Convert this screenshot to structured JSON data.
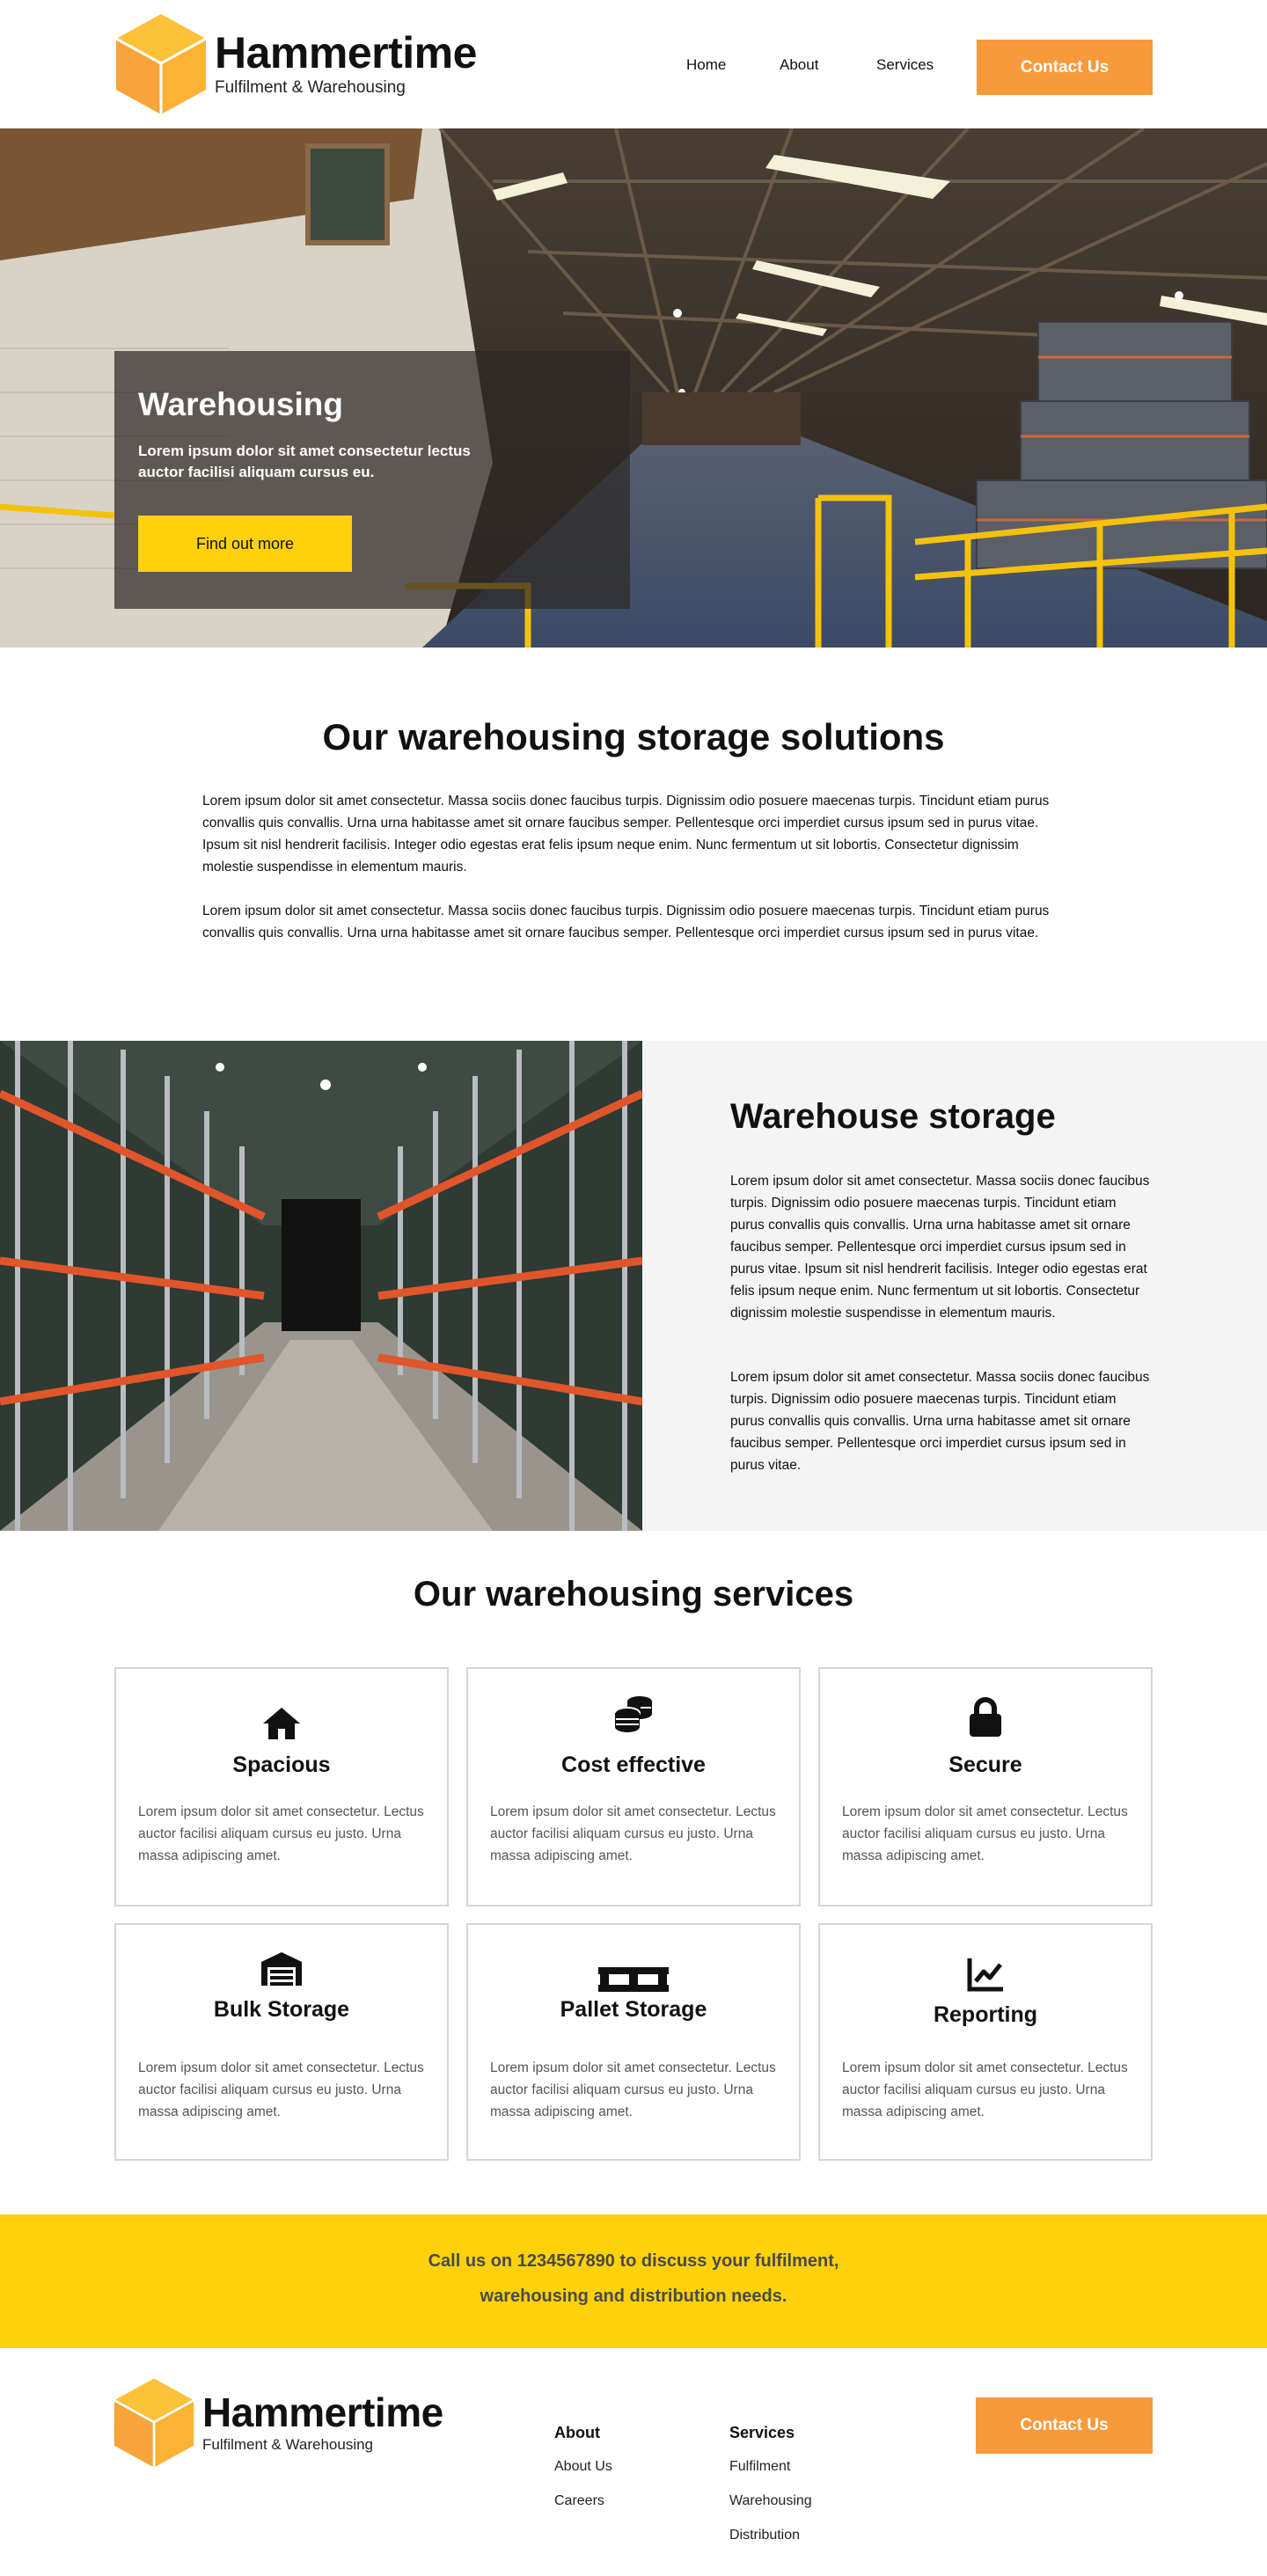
{
  "brand": {
    "name": "Hammertime",
    "tagline": "Fulfilment & Warehousing",
    "color_orange": "#f89a3c",
    "color_yellow": "#fdd20a"
  },
  "nav": {
    "items": [
      "Home",
      "About",
      "Services"
    ],
    "contact_label": "Contact Us"
  },
  "hero": {
    "title": "Warehousing",
    "text": "Lorem ipsum dolor sit amet consectetur lectus auctor facilisi aliquam cursus eu.",
    "button_label": "Find out more"
  },
  "solutions": {
    "title": "Our warehousing storage solutions",
    "paragraph1": "Lorem ipsum dolor sit amet consectetur. Massa sociis donec faucibus turpis. Dignissim odio posuere maecenas turpis. Tincidunt etiam purus convallis quis convallis. Urna urna habitasse amet sit ornare faucibus semper. Pellentesque orci imperdiet cursus ipsum sed in purus vitae. Ipsum sit nisl hendrerit facilisis. Integer odio egestas erat felis ipsum neque enim. Nunc fermentum ut sit lobortis. Consectetur dignissim molestie suspendisse in elementum mauris.",
    "paragraph2": "Lorem ipsum dolor sit amet consectetur. Massa sociis donec faucibus turpis. Dignissim odio posuere maecenas turpis. Tincidunt etiam purus convallis quis convallis. Urna urna habitasse amet sit ornare faucibus semper. Pellentesque orci imperdiet cursus ipsum sed in purus vitae."
  },
  "storage": {
    "title": "Warehouse storage",
    "paragraph1": "Lorem ipsum dolor sit amet consectetur. Massa sociis donec faucibus turpis. Dignissim odio posuere maecenas turpis. Tincidunt etiam purus convallis quis convallis. Urna urna habitasse amet sit ornare faucibus semper. Pellentesque orci imperdiet cursus ipsum sed in purus vitae. Ipsum sit nisl hendrerit facilisis. Integer odio egestas erat felis ipsum neque enim. Nunc fermentum ut sit lobortis. Consectetur dignissim molestie suspendisse in elementum mauris.",
    "paragraph2": "Lorem ipsum dolor sit amet consectetur. Massa sociis donec faucibus turpis. Dignissim odio posuere maecenas turpis. Tincidunt etiam purus convallis quis convallis. Urna urna habitasse amet sit ornare faucibus semper. Pellentesque orci imperdiet cursus ipsum sed in purus vitae."
  },
  "services": {
    "title": "Our warehousing services",
    "cards": [
      {
        "title": "Spacious",
        "icon": "house-icon",
        "text": "Lorem ipsum dolor sit amet consectetur. Lectus auctor facilisi aliquam cursus eu justo. Urna massa adipiscing amet."
      },
      {
        "title": "Cost effective",
        "icon": "coins-icon",
        "text": "Lorem ipsum dolor sit amet consectetur. Lectus auctor facilisi aliquam cursus eu justo. Urna massa adipiscing amet."
      },
      {
        "title": "Secure",
        "icon": "lock-icon",
        "text": "Lorem ipsum dolor sit amet consectetur. Lectus auctor facilisi aliquam cursus eu justo. Urna massa adipiscing amet."
      },
      {
        "title": "Bulk Storage",
        "icon": "warehouse-icon",
        "text": "Lorem ipsum dolor sit amet consectetur. Lectus auctor facilisi aliquam cursus eu justo. Urna massa adipiscing amet."
      },
      {
        "title": "Pallet Storage",
        "icon": "pallet-icon",
        "text": "Lorem ipsum dolor sit amet consectetur. Lectus auctor facilisi aliquam cursus eu justo. Urna massa adipiscing amet."
      },
      {
        "title": "Reporting",
        "icon": "chart-line-icon",
        "text": "Lorem ipsum dolor sit amet consectetur. Lectus auctor facilisi aliquam cursus eu justo. Urna massa adipiscing amet."
      }
    ]
  },
  "cta": {
    "line1": "Call us on 1234567890 to discuss your fulfilment,",
    "line2": "warehousing and distribution needs."
  },
  "footer": {
    "about_heading": "About",
    "about_links": [
      "About Us",
      "Careers"
    ],
    "services_heading": "Services",
    "services_links": [
      "Fulfilment",
      "Warehousing",
      "Distribution"
    ],
    "contact_label": "Contact Us"
  }
}
